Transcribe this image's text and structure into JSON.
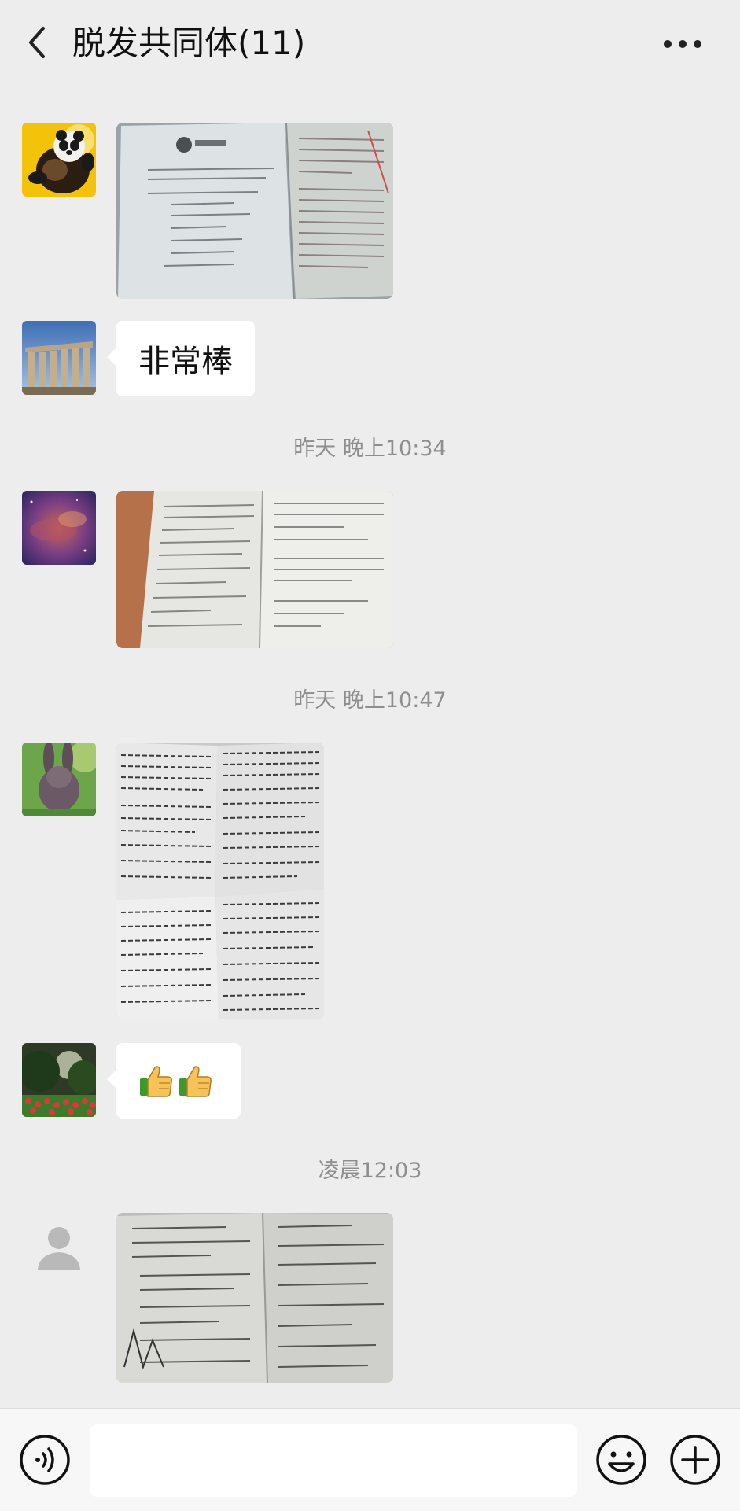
{
  "header": {
    "title": "脱发共同体(11)",
    "back_icon": "chevron-left-icon",
    "more_icon": "ellipsis-icon"
  },
  "messages": [
    {
      "type": "image",
      "content": "photo-of-open-exam-papers"
    },
    {
      "type": "text",
      "text": "非常棒"
    },
    {
      "type": "time",
      "text": "昨天 晚上10:34"
    },
    {
      "type": "image",
      "content": "photo-of-exam-booklet-on-desk"
    },
    {
      "type": "time",
      "text": "昨天 晚上10:47"
    },
    {
      "type": "image",
      "content": "photo-of-four-worksheets"
    },
    {
      "type": "emoji",
      "emojis": "👍👍"
    },
    {
      "type": "time",
      "text": "凌晨12:03"
    },
    {
      "type": "image",
      "content": "photo-of-handwritten-answers"
    }
  ],
  "input_bar": {
    "placeholder": "",
    "value": "",
    "voice_icon": "voice-icon",
    "emoji_icon": "emoji-face-icon",
    "plus_icon": "plus-icon"
  },
  "colors": {
    "background": "#ededed",
    "bubble": "#ffffff",
    "timestamp_text": "#8e8e8e",
    "input_bar": "#f7f7f7"
  }
}
